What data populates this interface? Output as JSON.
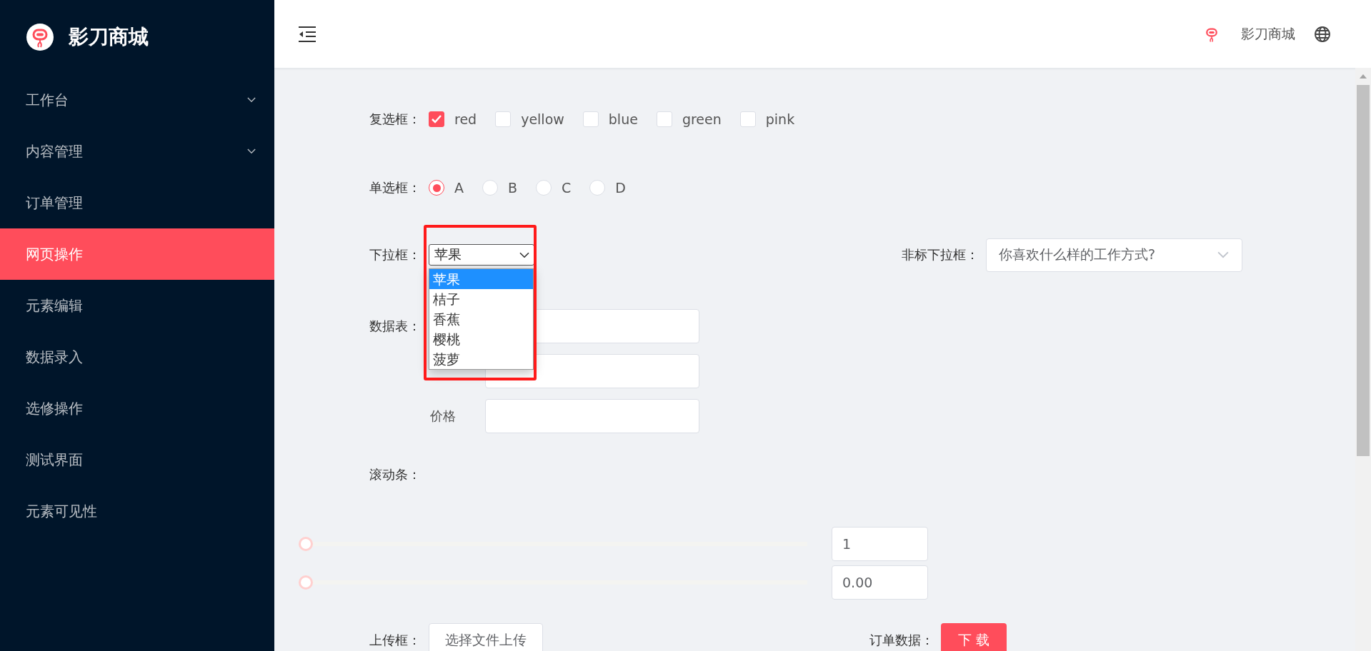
{
  "sidebar": {
    "brand": "影刀商城",
    "items": [
      {
        "label": "工作台",
        "kind": "group",
        "selected": false
      },
      {
        "label": "内容管理",
        "kind": "group",
        "selected": false
      },
      {
        "label": "订单管理",
        "kind": "link",
        "selected": false
      },
      {
        "label": "网页操作",
        "kind": "link",
        "selected": true
      },
      {
        "label": "元素编辑",
        "kind": "link",
        "selected": false
      },
      {
        "label": "数据录入",
        "kind": "link",
        "selected": false
      },
      {
        "label": "选修操作",
        "kind": "link",
        "selected": false
      },
      {
        "label": "测试界面",
        "kind": "link",
        "selected": false
      },
      {
        "label": "元素可见性",
        "kind": "link",
        "selected": false
      }
    ]
  },
  "header": {
    "brand": "影刀商城"
  },
  "form": {
    "checkbox_label": "复选框：",
    "checkboxes": [
      {
        "label": "red",
        "checked": true
      },
      {
        "label": "yellow",
        "checked": false
      },
      {
        "label": "blue",
        "checked": false
      },
      {
        "label": "green",
        "checked": false
      },
      {
        "label": "pink",
        "checked": false
      }
    ],
    "radio_label": "单选框：",
    "radios": [
      {
        "label": "A",
        "selected": true
      },
      {
        "label": "B",
        "selected": false
      },
      {
        "label": "C",
        "selected": false
      },
      {
        "label": "D",
        "selected": false
      }
    ],
    "select_label": "下拉框：",
    "select": {
      "value": "苹果",
      "expanded": true,
      "options": [
        {
          "label": "苹果",
          "selected": true
        },
        {
          "label": "桔子",
          "selected": false
        },
        {
          "label": "香蕉",
          "selected": false
        },
        {
          "label": "樱桃",
          "selected": false
        },
        {
          "label": "菠萝",
          "selected": false
        }
      ]
    },
    "custom_select_label": "非标下拉框：",
    "custom_select": {
      "placeholder": "你喜欢什么样的工作方式?"
    },
    "table_label": "数据表：",
    "table_rows": [
      {
        "kind": "hidden"
      },
      {
        "kind": "hidden"
      },
      {
        "kind": "labeled",
        "label": "价格"
      }
    ],
    "slider_label": "滚动条：",
    "sliders": [
      {
        "level": 0,
        "value": "1"
      },
      {
        "level": 0,
        "value": "0.00"
      }
    ],
    "upload_label": "上传框：",
    "upload_button": "选择文件上传",
    "order_label": "订单数据：",
    "download_button": "下 载"
  }
}
